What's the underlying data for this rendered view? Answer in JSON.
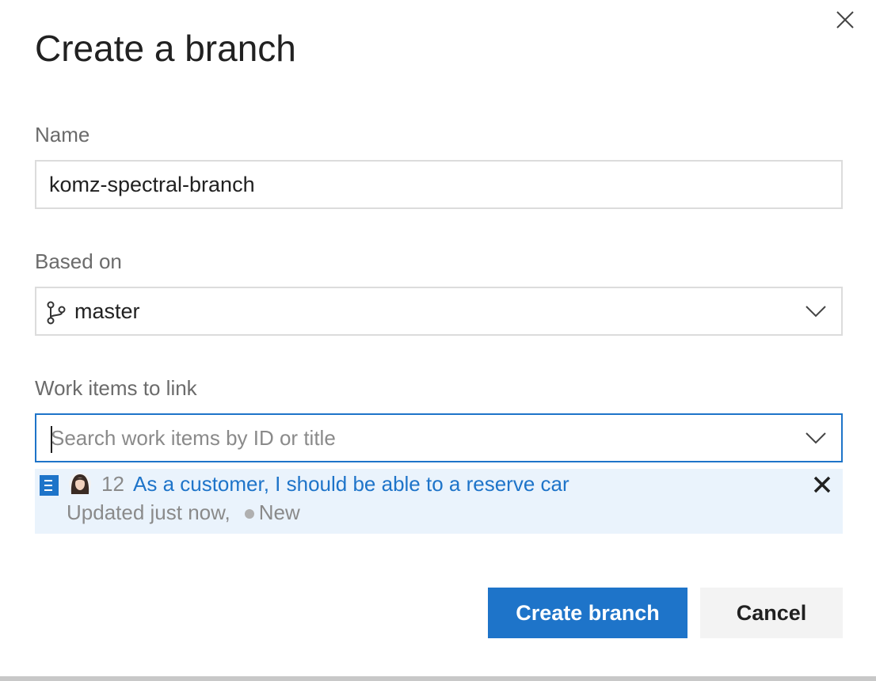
{
  "dialog": {
    "title": "Create a branch",
    "close_icon": "close-icon"
  },
  "name_field": {
    "label": "Name",
    "value": "komz-spectral-branch"
  },
  "based_on": {
    "label": "Based on",
    "value": "master",
    "icon": "branch-icon",
    "dropdown_icon": "chevron-down-icon"
  },
  "work_items": {
    "label": "Work items to link",
    "placeholder": "Search work items by ID or title",
    "dropdown_icon": "chevron-down-icon",
    "linked": [
      {
        "type_icon": "user-story-icon",
        "avatar": "avatar",
        "id": "12",
        "title": "As a customer, I should be able to a reserve car",
        "updated": "Updated just now,",
        "state": "New",
        "remove_icon": "close-icon"
      }
    ]
  },
  "actions": {
    "create_label": "Create branch",
    "cancel_label": "Cancel"
  },
  "colors": {
    "accent": "#1e74c9",
    "selected_row_bg": "#eaf3fc",
    "label_text": "#6b6b6b"
  }
}
